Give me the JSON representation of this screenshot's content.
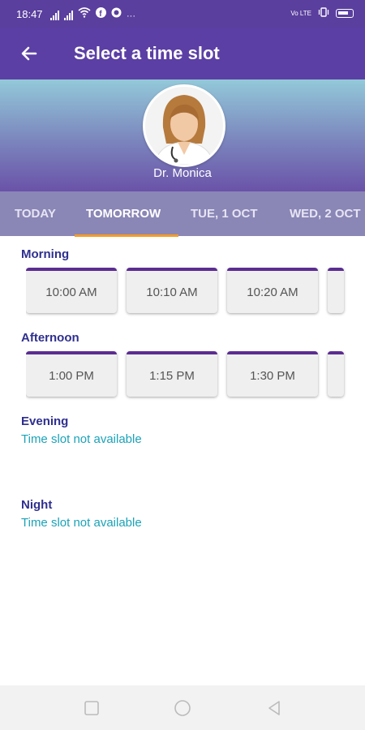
{
  "status_bar": {
    "time": "18:47",
    "right_text": "Vo LTE"
  },
  "app_bar": {
    "title": "Select a time slot",
    "back_icon": "arrow-back-icon"
  },
  "doctor": {
    "name": "Dr. Monica"
  },
  "tabs": [
    {
      "label": "TODAY",
      "active": false
    },
    {
      "label": "TOMORROW",
      "active": true
    },
    {
      "label": "TUE, 1 OCT",
      "active": false
    },
    {
      "label": "WED, 2 OCT",
      "active": false
    }
  ],
  "sections": {
    "morning": {
      "title": "Morning",
      "slots": [
        "10:00 AM",
        "10:10 AM",
        "10:20 AM"
      ]
    },
    "afternoon": {
      "title": "Afternoon",
      "slots": [
        "1:00 PM",
        "1:15 PM",
        "1:30 PM"
      ]
    },
    "evening": {
      "title": "Evening",
      "message": "Time slot not available"
    },
    "night": {
      "title": "Night",
      "message": "Time slot not available"
    }
  },
  "colors": {
    "primary": "#5b3fa4",
    "tab_indicator": "#f39c2a",
    "section_title": "#2f2f8f",
    "not_available": "#1ba3b8",
    "slot_accent": "#5b2d91"
  }
}
